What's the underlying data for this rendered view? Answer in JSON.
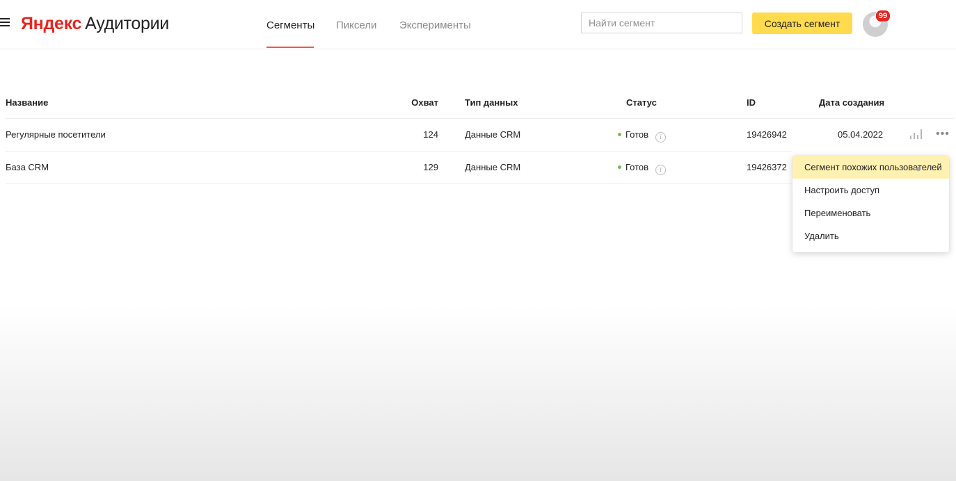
{
  "header": {
    "logo_brand": "Яндекс",
    "logo_product": "Аудитории",
    "tabs": [
      {
        "label": "Сегменты",
        "active": true
      },
      {
        "label": "Пиксели",
        "active": false
      },
      {
        "label": "Эксперименты",
        "active": false
      }
    ],
    "search_placeholder": "Найти сегмент",
    "create_label": "Создать сегмент",
    "notifications_count": "99"
  },
  "table": {
    "columns": [
      "Название",
      "Охват",
      "Тип данных",
      "Статус",
      "ID",
      "Дата создания"
    ],
    "rows": [
      {
        "name": "Регулярные посетители",
        "reach": "124",
        "type": "Данные CRM",
        "status": "Готов",
        "id": "19426942",
        "date": "05.04.2022"
      },
      {
        "name": "База CRM",
        "reach": "129",
        "type": "Данные CRM",
        "status": "Готов",
        "id": "19426372",
        "date": ""
      }
    ]
  },
  "context_menu": {
    "items": [
      "Сегмент похожих пользователей",
      "Настроить доступ",
      "Переименовать",
      "Удалить"
    ],
    "highlighted_index": 0
  },
  "colors": {
    "accent_yellow": "#ffdb4d",
    "brand_red": "#e52620",
    "tab_underline": "#f0574a",
    "status_ok": "#6fbf52",
    "menu_highlight": "#fff1b2"
  }
}
